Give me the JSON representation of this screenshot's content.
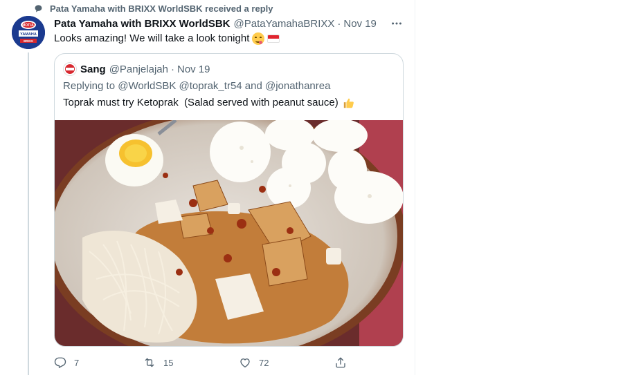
{
  "social_context": {
    "text": "Pata Yamaha with BRIXX WorldSBK received a reply",
    "icon": "reply-bubble-icon"
  },
  "tweet": {
    "author_name": "Pata Yamaha with BRIXX WorldSBK",
    "author_handle": "@PataYamahaBRIXX",
    "separator": "·",
    "timestamp": "Nov 19",
    "text": "Looks amazing! We will take a look tonight",
    "emojis": [
      "face-savoring-food-emoji",
      "indonesia-flag-emoji"
    ],
    "avatar_logo_top": "MOTUL",
    "avatar_logo_mid": "YAMAHA",
    "avatar_logo_bottom": "BRIXX"
  },
  "quoted_tweet": {
    "author_name": "Sang",
    "author_handle": "@Panjelajah",
    "separator": "·",
    "timestamp": "Nov 19",
    "replying_to": "Replying to @WorldSBK @toprak_tr54 and @jonathanrea",
    "text": "Toprak must try Ketoprak  (Salad served with peanut sauce)",
    "emoji": "thumbs-up-emoji",
    "media_description_icon": "food-photo-image"
  },
  "actions": {
    "reply_count": "7",
    "retweet_count": "15",
    "like_count": "72"
  },
  "colors": {
    "secondary_text": "#536471",
    "border": "#cfd9de",
    "avatar_bg": "#1b3a8f"
  }
}
